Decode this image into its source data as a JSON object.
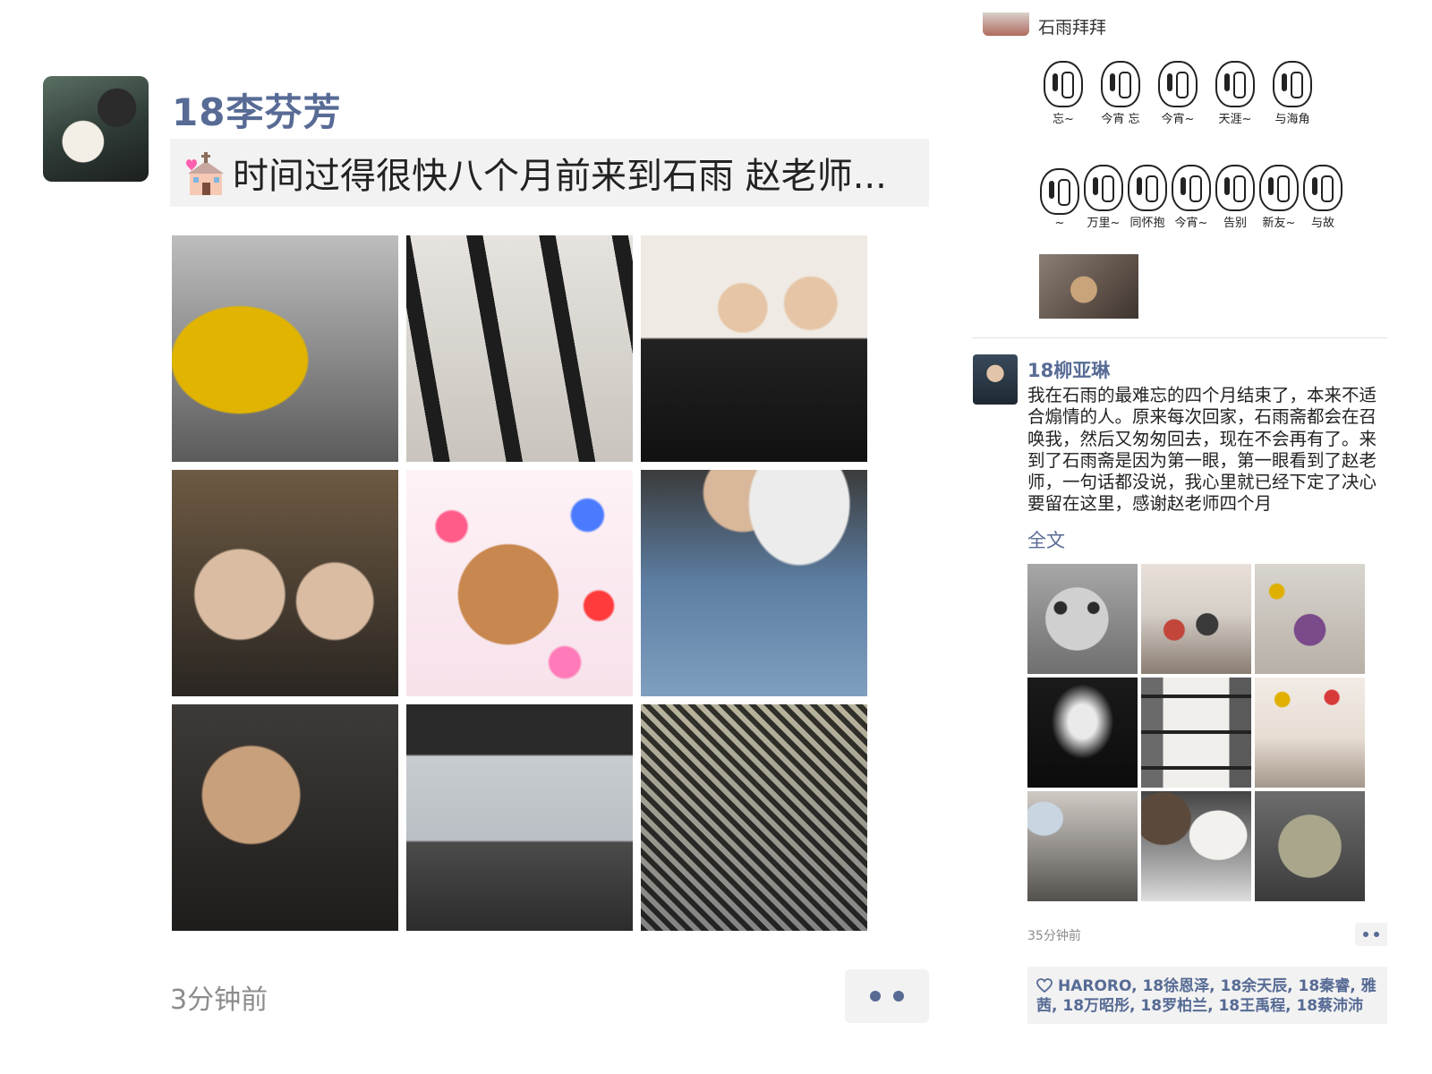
{
  "left_post": {
    "author": "18李芬芳",
    "share_text": "时间过得很快八个月前来到石雨 赵老师...",
    "share_icon": "chapel-with-heart-icon",
    "time": "3分钟前",
    "more_icon": "more-dots-icon",
    "photos": [
      {
        "icon": "photo-girl-yellow-hood"
      },
      {
        "icon": "photo-calligraphy"
      },
      {
        "icon": "photo-two-boys"
      },
      {
        "icon": "photo-two-girls-selfie"
      },
      {
        "icon": "photo-jerry-hearts"
      },
      {
        "icon": "photo-denim-jacket"
      },
      {
        "icon": "photo-man-dark"
      },
      {
        "icon": "photo-cafe-silhouette"
      },
      {
        "icon": "photo-seal-print"
      }
    ]
  },
  "top_post_tail": {
    "author": "石雨拜拜",
    "stickers_row1": [
      "忘~",
      "今宵 忘",
      "今宵~",
      "天涯~",
      "与海角"
    ],
    "stickers_row2": [
      "~",
      "万里~",
      "同怀抱",
      "今宵~",
      "告别",
      "新友~",
      "与故"
    ]
  },
  "right_post": {
    "author": "18柳亚琳",
    "body": "我在石雨的最难忘的四个月结束了，本来不适合煽情的人。原来每次回家，石雨斋都会在召唤我，然后又匆匆回去，现在不会再有了。来到了石雨斋是因为第一眼，第一眼看到了赵老师，一句话都没说，我心里就已经下定了决心要留在这里，感谢赵老师四个月",
    "fulltext_link": "全文",
    "time": "35分钟前",
    "likes": "HARORO, 18徐恩泽, 18余天辰, 18秦睿, 雅茜, 18万昭彤, 18罗柏兰, 18王禹程, 18蔡沛沛",
    "photos": [
      {
        "icon": "photo-kitten"
      },
      {
        "icon": "photo-dining-hall"
      },
      {
        "icon": "photo-party-group"
      },
      {
        "icon": "photo-wall-sign"
      },
      {
        "icon": "photo-calligraphy-scroll"
      },
      {
        "icon": "photo-balloons-room"
      },
      {
        "icon": "photo-street-walk"
      },
      {
        "icon": "photo-bowls"
      },
      {
        "icon": "photo-stone-seal"
      }
    ]
  }
}
